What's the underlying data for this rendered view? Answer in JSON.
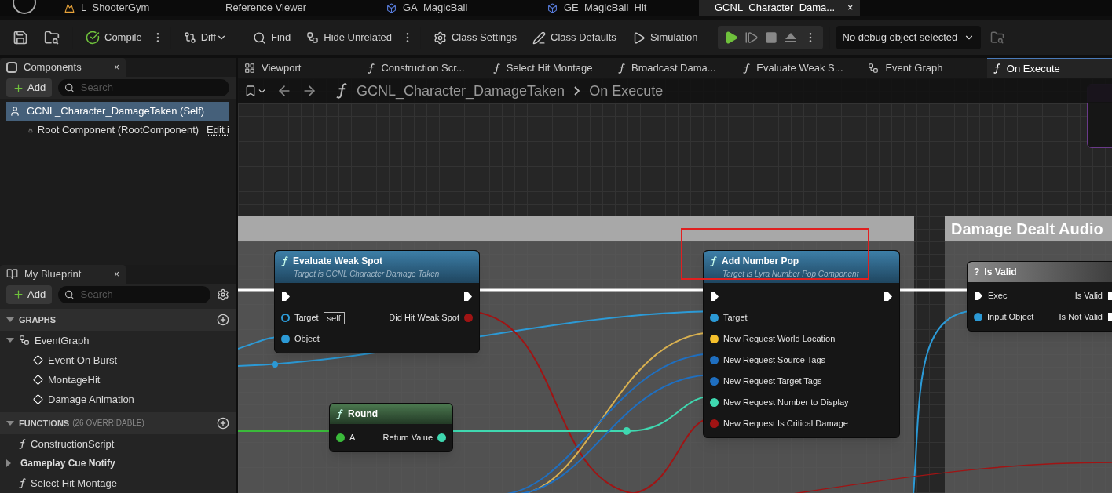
{
  "doc_tabs": [
    {
      "label": "L_ShooterGym",
      "kind": "level",
      "selected": false
    },
    {
      "label": "Reference Viewer",
      "kind": "plain",
      "selected": false
    },
    {
      "label": "GA_MagicBall",
      "kind": "asset",
      "selected": false
    },
    {
      "label": "GE_MagicBall_Hit",
      "kind": "asset",
      "selected": false
    },
    {
      "label": "GCNL_Character_Dama...",
      "kind": "blueprint",
      "selected": true,
      "close": "×"
    }
  ],
  "toolbar": {
    "compile": "Compile",
    "diff": "Diff",
    "find": "Find",
    "hide_unrelated": "Hide Unrelated",
    "class_settings": "Class Settings",
    "class_defaults": "Class Defaults",
    "simulation": "Simulation",
    "debug_select": "No debug object selected"
  },
  "components_panel": {
    "title": "Components",
    "close": "×",
    "add": "Add",
    "search_placeholder": "Search",
    "tree": [
      {
        "label": "GCNL_Character_DamageTaken (Self)",
        "selected": true,
        "children": [
          {
            "label": "Root Component (RootComponent)",
            "link": "Edit i",
            "selected": false
          }
        ]
      }
    ]
  },
  "my_blueprint": {
    "title": "My Blueprint",
    "close": "×",
    "add": "Add",
    "search_placeholder": "Search",
    "sections": [
      {
        "title": "GRAPHS",
        "expanded": true,
        "items": [
          {
            "label": "EventGraph",
            "kind": "graph",
            "expanded": true,
            "children": [
              {
                "label": "Event On Burst",
                "kind": "event"
              },
              {
                "label": "MontageHit",
                "kind": "event"
              },
              {
                "label": "Damage Animation",
                "kind": "event"
              }
            ]
          }
        ]
      },
      {
        "title": "FUNCTIONS",
        "note": "(26 OVERRIDABLE)",
        "expanded": true,
        "items": [
          {
            "label": "ConstructionScript",
            "kind": "construct"
          },
          {
            "label": "Gameplay Cue Notify",
            "kind": "category",
            "expanded": false
          },
          {
            "label": "Select Hit Montage",
            "kind": "function"
          }
        ]
      }
    ]
  },
  "graph_tabs": [
    {
      "label": "Viewport",
      "kind": "viewport",
      "selected": false
    },
    {
      "label": "Construction Scr...",
      "kind": "function",
      "selected": false
    },
    {
      "label": "Select Hit Montage",
      "kind": "function",
      "selected": false
    },
    {
      "label": "Broadcast Dama...",
      "kind": "function",
      "selected": false
    },
    {
      "label": "Evaluate Weak S...",
      "kind": "function",
      "selected": false
    },
    {
      "label": "Event Graph",
      "kind": "graph",
      "selected": false
    },
    {
      "label": "On Execute",
      "kind": "function",
      "selected": true
    }
  ],
  "breadcrumb": [
    "GCNL_Character_DamageTaken",
    "On Execute"
  ],
  "graph": {
    "comments": [
      {
        "kind": "plain"
      },
      {
        "kind": "titled",
        "title": "Damage Dealt Audio"
      }
    ],
    "nodes": [
      {
        "title": "Evaluate Weak Spot",
        "subtitle": "Target is GCNL Character Damage Taken",
        "kind": "function",
        "inputs": [
          {
            "kind": "exec"
          },
          {
            "label": "Target",
            "kind": "object",
            "connected": false,
            "value": "self"
          },
          {
            "label": "Object",
            "kind": "object",
            "connected": true
          }
        ],
        "outputs": [
          {
            "kind": "exec"
          },
          {
            "label": "Did Hit Weak Spot",
            "kind": "bool",
            "connected": true
          }
        ]
      },
      {
        "title": "Add Number Pop",
        "subtitle": "Target is Lyra Number Pop Component",
        "kind": "function",
        "highlighted": true,
        "inputs": [
          {
            "kind": "exec"
          },
          {
            "label": "Target",
            "kind": "object",
            "connected": true
          },
          {
            "label": "New Request World Location",
            "kind": "vector",
            "connected": true
          },
          {
            "label": "New Request Source Tags",
            "kind": "struct",
            "connected": true
          },
          {
            "label": "New Request Target Tags",
            "kind": "struct",
            "connected": true
          },
          {
            "label": "New Request Number to Display",
            "kind": "int",
            "connected": true
          },
          {
            "label": "New Request Is Critical Damage",
            "kind": "bool",
            "connected": true
          }
        ],
        "outputs": [
          {
            "kind": "exec"
          }
        ]
      },
      {
        "title": "Round",
        "kind": "pure",
        "inputs": [
          {
            "label": "A",
            "kind": "float",
            "connected": true
          }
        ],
        "outputs": [
          {
            "label": "Return Value",
            "kind": "int",
            "connected": true
          }
        ]
      },
      {
        "title": "Is Valid",
        "kind": "macro",
        "glyph": "?",
        "inputs": [
          {
            "label": "Exec",
            "kind": "exec"
          },
          {
            "label": "Input Object",
            "kind": "object",
            "connected": true
          }
        ],
        "outputs": [
          {
            "label": "Is Valid",
            "kind": "exec"
          },
          {
            "label": "Is Not Valid",
            "kind": "exec"
          }
        ]
      }
    ]
  }
}
